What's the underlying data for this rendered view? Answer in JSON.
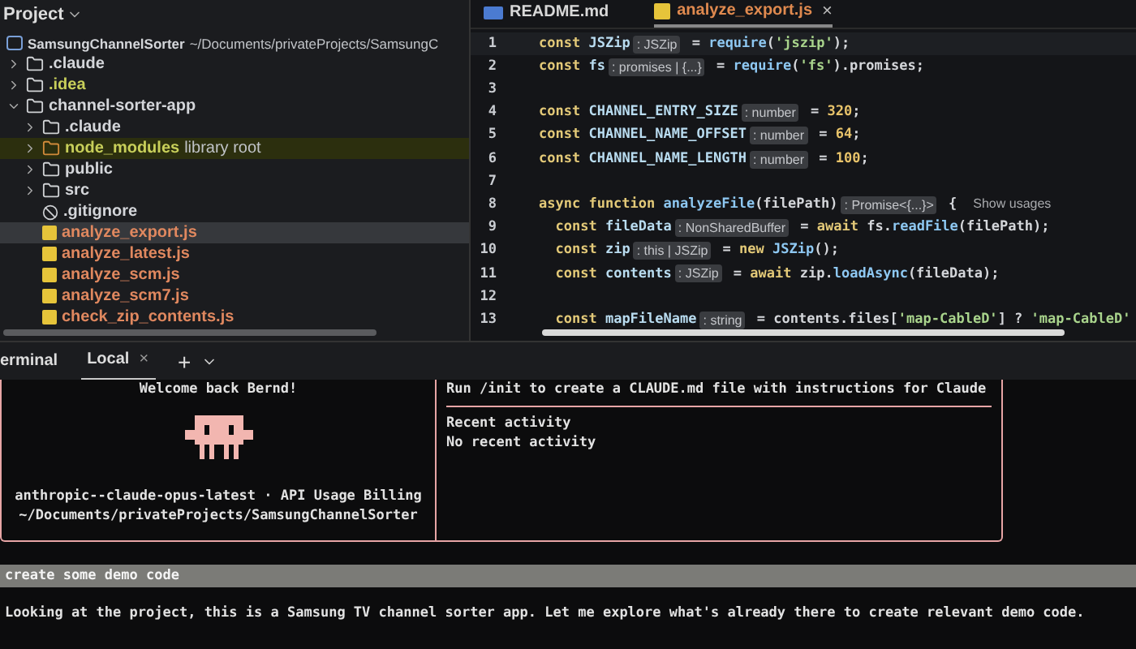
{
  "project_panel": {
    "title": "Project",
    "tree": [
      {
        "name": "SamsungChannelSorter",
        "kind": "root",
        "path": "~/Documents/privateProjects/SamsungC",
        "color": "#d4d6da",
        "selected": false,
        "children": [
          {
            "name": ".claude",
            "kind": "folder",
            "expanded": false,
            "color": "#d4d6da",
            "selected": false
          },
          {
            "name": ".idea",
            "kind": "folder",
            "expanded": false,
            "color": "#c8cf5a",
            "selected": false
          },
          {
            "name": "channel-sorter-app",
            "kind": "folder",
            "expanded": true,
            "color": "#d4d6da",
            "selected": false,
            "children": [
              {
                "name": ".claude",
                "kind": "folder",
                "expanded": false,
                "color": "#d4d6da",
                "selected": false
              },
              {
                "name": "node_modules",
                "kind": "library",
                "tag": "library root",
                "expanded": false,
                "color": "#c8cf5a",
                "selected": false
              },
              {
                "name": "public",
                "kind": "folder",
                "expanded": false,
                "color": "#d4d6da",
                "selected": false
              },
              {
                "name": "src",
                "kind": "folder",
                "expanded": false,
                "color": "#d4d6da",
                "selected": false
              },
              {
                "name": ".gitignore",
                "kind": "ignore-file",
                "color": "#d4d6da",
                "selected": false
              },
              {
                "name": "analyze_export.js",
                "kind": "js-file",
                "color": "#e0885f",
                "selected": true
              },
              {
                "name": "analyze_latest.js",
                "kind": "js-file",
                "color": "#e0885f",
                "selected": false
              },
              {
                "name": "analyze_scm.js",
                "kind": "js-file",
                "color": "#e0885f",
                "selected": false
              },
              {
                "name": "analyze_scm7.js",
                "kind": "js-file",
                "color": "#e0885f",
                "selected": false
              },
              {
                "name": "check_zip_contents.js",
                "kind": "js-file",
                "color": "#e0885f",
                "selected": false
              }
            ]
          }
        ]
      }
    ]
  },
  "editor": {
    "tabs": [
      {
        "label": "README.md",
        "kind": "markdown",
        "selected": false
      },
      {
        "label": "analyze_export.js",
        "kind": "js",
        "selected": true,
        "close": "×"
      }
    ],
    "lines": [
      {
        "number": "1",
        "segments": [
          {
            "kind": "kw",
            "text": "const "
          },
          {
            "kind": "id",
            "text": "JSZip"
          },
          {
            "kind": "hint",
            "text": ": JSZip"
          },
          {
            "kind": "plain",
            "text": " = "
          },
          {
            "kind": "fn",
            "text": "require"
          },
          {
            "kind": "plain",
            "text": "("
          },
          {
            "kind": "str",
            "text": "'jszip'"
          },
          {
            "kind": "plain",
            "text": ");"
          }
        ]
      },
      {
        "number": "2",
        "segments": [
          {
            "kind": "kw",
            "text": "const "
          },
          {
            "kind": "id",
            "text": "fs"
          },
          {
            "kind": "hint",
            "text": ": promises | {...}"
          },
          {
            "kind": "plain",
            "text": " = "
          },
          {
            "kind": "fn",
            "text": "require"
          },
          {
            "kind": "plain",
            "text": "("
          },
          {
            "kind": "str",
            "text": "'fs'"
          },
          {
            "kind": "plain",
            "text": ").promises;"
          }
        ]
      },
      {
        "number": "3"
      },
      {
        "number": "4",
        "segments": [
          {
            "kind": "kw",
            "text": "const "
          },
          {
            "kind": "id",
            "text": "CHANNEL_ENTRY_SIZE"
          },
          {
            "kind": "hint",
            "text": ": number"
          },
          {
            "kind": "plain",
            "text": " = "
          },
          {
            "kind": "num",
            "text": "320"
          },
          {
            "kind": "plain",
            "text": ";"
          }
        ]
      },
      {
        "number": "5",
        "segments": [
          {
            "kind": "kw",
            "text": "const "
          },
          {
            "kind": "id",
            "text": "CHANNEL_NAME_OFFSET"
          },
          {
            "kind": "hint",
            "text": ": number"
          },
          {
            "kind": "plain",
            "text": " = "
          },
          {
            "kind": "num",
            "text": "64"
          },
          {
            "kind": "plain",
            "text": ";"
          }
        ]
      },
      {
        "number": "6",
        "segments": [
          {
            "kind": "kw",
            "text": "const "
          },
          {
            "kind": "id",
            "text": "CHANNEL_NAME_LENGTH"
          },
          {
            "kind": "hint",
            "text": ": number"
          },
          {
            "kind": "plain",
            "text": " = "
          },
          {
            "kind": "num",
            "text": "100"
          },
          {
            "kind": "plain",
            "text": ";"
          }
        ]
      },
      {
        "number": "7"
      },
      {
        "number": "8",
        "segments": [
          {
            "kind": "kw",
            "text": "async function "
          },
          {
            "kind": "fn",
            "text": "analyzeFile"
          },
          {
            "kind": "plain",
            "text": "(filePath)"
          },
          {
            "kind": "hint",
            "text": ": Promise<{...}>"
          },
          {
            "kind": "plain",
            "text": " {"
          },
          {
            "kind": "link",
            "text": "Show usages"
          }
        ]
      },
      {
        "number": "9",
        "segments": [
          {
            "kind": "kw",
            "text": "  const "
          },
          {
            "kind": "id",
            "text": "fileData"
          },
          {
            "kind": "hint",
            "text": ": NonSharedBuffer"
          },
          {
            "kind": "plain",
            "text": " = "
          },
          {
            "kind": "kw",
            "text": "await "
          },
          {
            "kind": "plain",
            "text": "fs."
          },
          {
            "kind": "fn",
            "text": "readFile"
          },
          {
            "kind": "plain",
            "text": "(filePath);"
          }
        ]
      },
      {
        "number": "10",
        "segments": [
          {
            "kind": "kw",
            "text": "  const "
          },
          {
            "kind": "id",
            "text": "zip"
          },
          {
            "kind": "hint",
            "text": ": this | JSZip"
          },
          {
            "kind": "plain",
            "text": " = "
          },
          {
            "kind": "kw",
            "text": "new "
          },
          {
            "kind": "fn",
            "text": "JSZip"
          },
          {
            "kind": "plain",
            "text": "();"
          }
        ]
      },
      {
        "number": "11",
        "segments": [
          {
            "kind": "kw",
            "text": "  const "
          },
          {
            "kind": "id",
            "text": "contents"
          },
          {
            "kind": "hint",
            "text": ": JSZip"
          },
          {
            "kind": "plain",
            "text": " = "
          },
          {
            "kind": "kw",
            "text": "await "
          },
          {
            "kind": "plain",
            "text": "zip."
          },
          {
            "kind": "fn",
            "text": "loadAsync"
          },
          {
            "kind": "plain",
            "text": "(fileData);"
          }
        ]
      },
      {
        "number": "12"
      },
      {
        "number": "13",
        "segments": [
          {
            "kind": "kw",
            "text": "  const "
          },
          {
            "kind": "id",
            "text": "mapFileName"
          },
          {
            "kind": "hint",
            "text": ": string"
          },
          {
            "kind": "plain",
            "text": " = contents.files["
          },
          {
            "kind": "str",
            "text": "'map-CableD'"
          },
          {
            "kind": "plain",
            "text": "] ? "
          },
          {
            "kind": "str",
            "text": "'map-CableD'"
          }
        ]
      }
    ]
  },
  "terminal": {
    "title": "erminal",
    "tabs": [
      {
        "label": "Local",
        "selected": true,
        "close": "×"
      }
    ],
    "add": "+",
    "welcome": {
      "greeting": "Welcome back Bernd!",
      "model_line": "anthropic--claude-opus-latest · API Usage Billing",
      "cwd": "~/Documents/privateProjects/SamsungChannelSorter"
    },
    "tips": {
      "text": "Run /init to create a CLAUDE.md file with instructions for Claude",
      "recent_title": "Recent activity",
      "recent_text": "No recent activity"
    },
    "prompt": "create some demo code",
    "response": "Looking at the project, this is a Samsung TV channel sorter app. Let me explore what's already there to create relevant demo code."
  }
}
